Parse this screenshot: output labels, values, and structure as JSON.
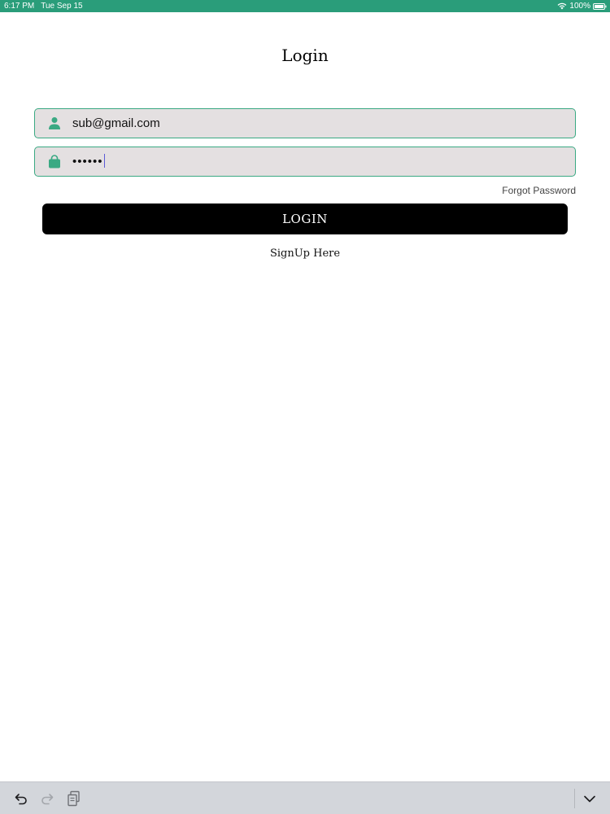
{
  "status_bar": {
    "time": "6:17 PM",
    "date": "Tue Sep 15",
    "battery": "100%",
    "icons": [
      "wifi-icon",
      "battery-icon"
    ],
    "background_color": "#2a9d7a"
  },
  "title": "Login",
  "email_field": {
    "icon": "user-icon",
    "value": "sub@gmail.com"
  },
  "password_field": {
    "icon": "lock-icon",
    "value": "••••••"
  },
  "forgot_password": "Forgot Password",
  "login_button": "LOGIN",
  "signup_link": "SignUp Here",
  "keyboard_toolbar": {
    "items": [
      "undo-icon",
      "redo-icon",
      "paste-icon",
      "dismiss-keyboard-icon"
    ]
  },
  "colors": {
    "accent": "#3aa983",
    "field_background": "#e4e0e1",
    "button_background": "#000000"
  }
}
